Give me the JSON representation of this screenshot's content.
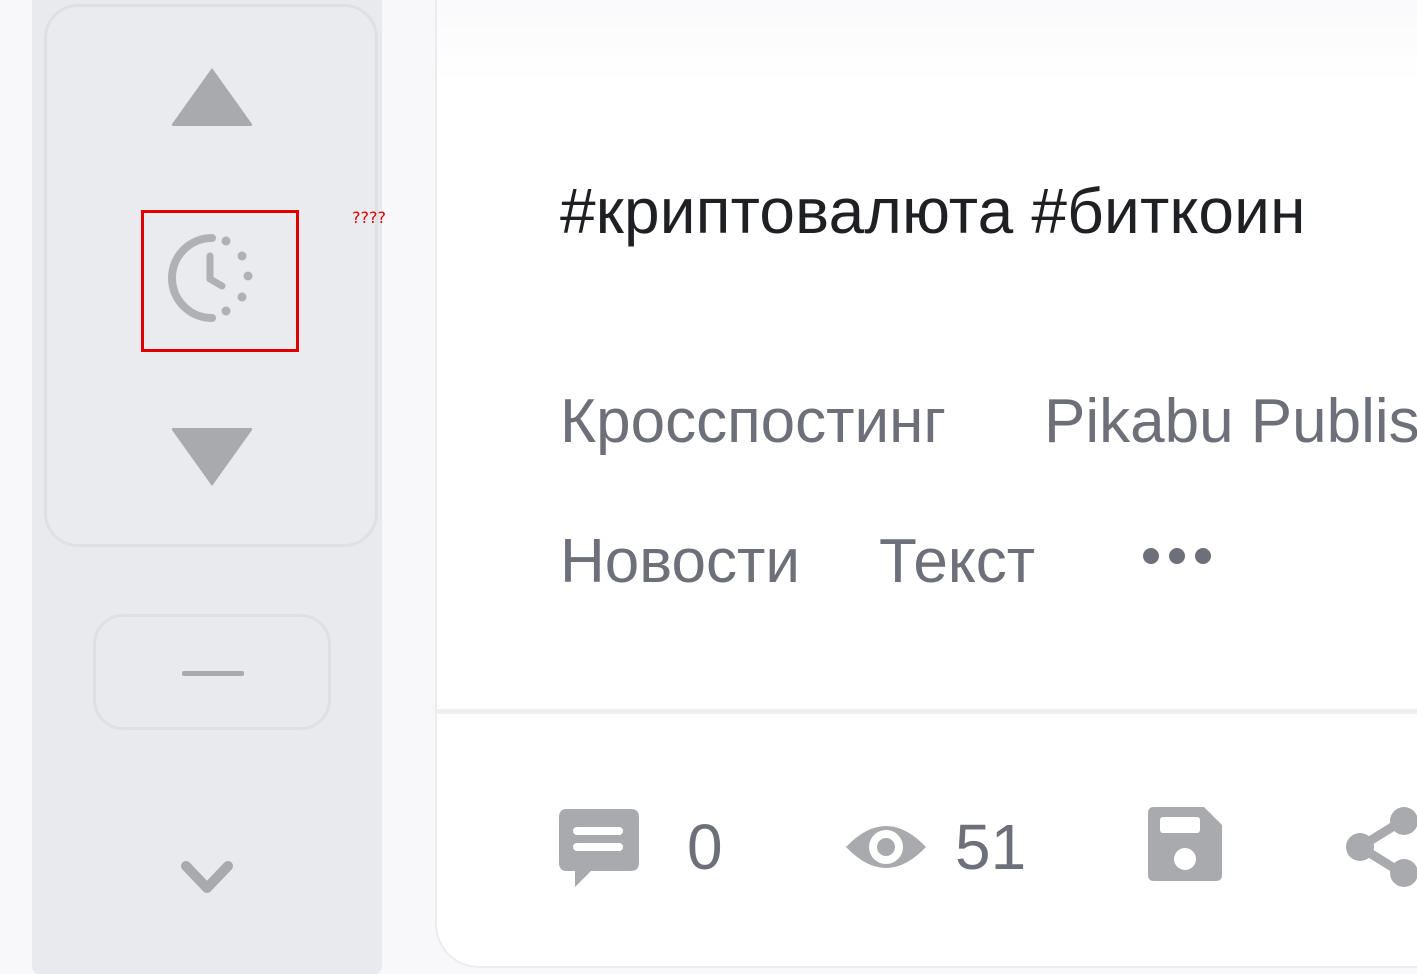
{
  "annotation": {
    "text": "????"
  },
  "post": {
    "title": "#криптовалюта #биткоин",
    "tags": [
      "Кросспостинг",
      "Pikabu Publish",
      "Новости",
      "Текст"
    ]
  },
  "stats": {
    "comments": "0",
    "views": "51"
  },
  "icons": {
    "vote_up": "triangle-up-icon",
    "timer": "timer-clock-icon",
    "vote_down": "triangle-down-icon",
    "minus": "minus-icon",
    "chevron": "chevron-down-icon",
    "more": "more-dots-icon",
    "comments": "comment-icon",
    "views": "eye-icon",
    "save": "save-icon",
    "share": "share-icon"
  },
  "colors": {
    "icon_gray": "#a9aaae",
    "text_gray": "#6e7079",
    "title_text": "#1f2024",
    "highlight_red": "#e00000"
  }
}
